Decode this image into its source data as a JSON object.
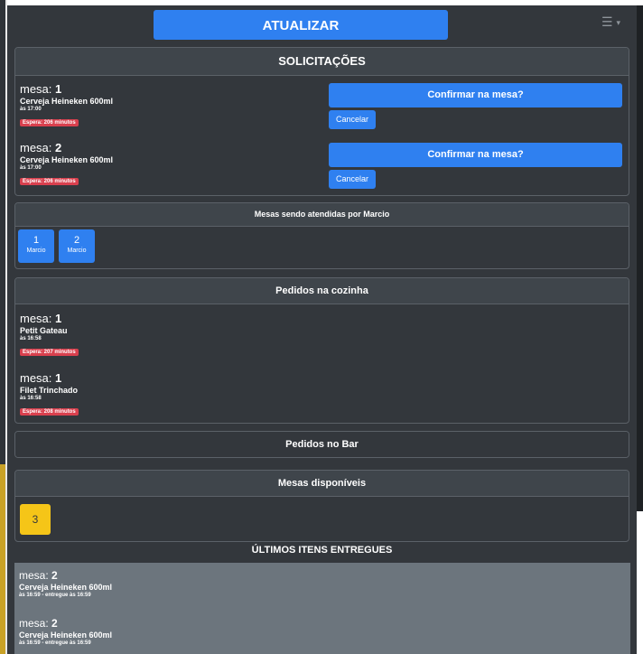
{
  "header": {
    "refresh_label": "ATUALIZAR",
    "menu_icon": "hamburger-icon"
  },
  "requests": {
    "title": "SOLICITAÇÕES",
    "orders": [
      {
        "mesa_label": "mesa:",
        "mesa_number": "1",
        "item": "Cerveja Heineken 600ml",
        "time": "às 17:00",
        "wait": "Espera: 206 minutos",
        "confirm_label": "Confirmar na mesa?",
        "cancel_label": "Cancelar"
      },
      {
        "mesa_label": "mesa:",
        "mesa_number": "2",
        "item": "Cerveja Heineken 600ml",
        "time": "às 17:00",
        "wait": "Espera: 206 minutos",
        "confirm_label": "Confirmar na mesa?",
        "cancel_label": "Cancelar"
      }
    ]
  },
  "served_tables": {
    "title": "Mesas sendo atendidas por Marcio",
    "tables": [
      {
        "number": "1",
        "waiter": "Marcio"
      },
      {
        "number": "2",
        "waiter": "Marcio"
      }
    ]
  },
  "kitchen": {
    "title": "Pedidos na cozinha",
    "orders": [
      {
        "mesa_label": "mesa:",
        "mesa_number": "1",
        "item": "Petit Gateau",
        "time": "às 16:58",
        "wait": "Espera: 207 minutos"
      },
      {
        "mesa_label": "mesa:",
        "mesa_number": "1",
        "item": "Filet Trinchado",
        "time": "às 16:58",
        "wait": "Espera: 208 minutos"
      }
    ]
  },
  "bar": {
    "title": "Pedidos no Bar"
  },
  "available": {
    "title": "Mesas disponíveis",
    "tables": [
      "3"
    ]
  },
  "delivered": {
    "title": "ÚLTIMOS ITENS ENTREGUES",
    "items": [
      {
        "mesa_label": "mesa:",
        "mesa_number": "2",
        "item": "Cerveja Heineken 600ml",
        "time": "às 16:59 - entregue às 16:59"
      },
      {
        "mesa_label": "mesa:",
        "mesa_number": "2",
        "item": "Cerveja Heineken 600ml",
        "time": "às 16:59 - entregue às 16:59"
      }
    ]
  },
  "colors": {
    "background": "#33373c",
    "primary": "#2f80f0",
    "danger": "#d9404e",
    "warning": "#f5c518",
    "muted": "#6c757d"
  }
}
